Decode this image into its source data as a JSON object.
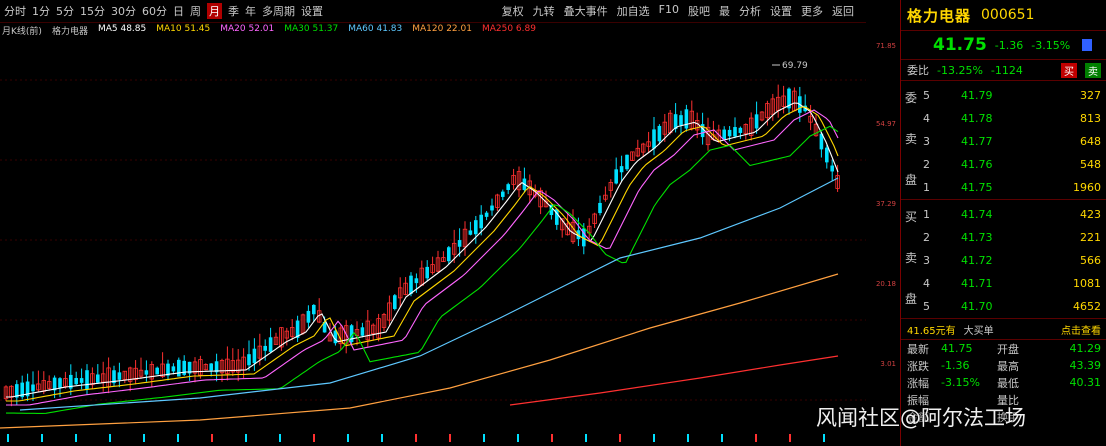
{
  "toolbar": {
    "periods": [
      "分时",
      "1分",
      "5分",
      "15分",
      "30分",
      "60分",
      "日",
      "周",
      "月",
      "季",
      "年",
      "多周期",
      "设置"
    ],
    "active_period": "月",
    "right_tools": [
      "复权",
      "九转",
      "叠大事件",
      "加自选",
      "F10",
      "股吧",
      "最",
      "分析",
      "设置",
      "更多",
      "返回"
    ]
  },
  "ma_legend": [
    {
      "text": "月K线(前)",
      "color": "#c8c8c8"
    },
    {
      "text": "格力电器",
      "color": "#c8c8c8"
    },
    {
      "text": "MA5 48.85",
      "color": "#ffffff"
    },
    {
      "text": "MA10 51.45",
      "color": "#ffd700"
    },
    {
      "text": "MA20 52.01",
      "color": "#ff66ff"
    },
    {
      "text": "MA30 51.37",
      "color": "#00e000"
    },
    {
      "text": "MA60 41.83",
      "color": "#5ec8ff"
    },
    {
      "text": "MA120 22.01",
      "color": "#ffa040"
    },
    {
      "text": "MA250 6.89",
      "color": "#ff3030"
    }
  ],
  "axis_labels": [
    "71.85",
    "54.97",
    "37.29",
    "20.18",
    "3.01"
  ],
  "peak_label": "69.79",
  "quote": {
    "name": "格力电器",
    "code": "000651",
    "price": "41.75",
    "change": "-1.36",
    "percent": "-3.15%"
  },
  "ratio": {
    "label": "委比",
    "value": "-13.25%",
    "diff": "-1124",
    "sell": "买",
    "buy": "卖"
  },
  "sell_side_label": [
    "委",
    "卖",
    "盘"
  ],
  "buy_side_label": [
    "买",
    "卖",
    "盘"
  ],
  "sell_levels": [
    {
      "level": "5",
      "price": "41.79",
      "volume": "327"
    },
    {
      "level": "4",
      "price": "41.78",
      "volume": "813"
    },
    {
      "level": "3",
      "price": "41.77",
      "volume": "648"
    },
    {
      "level": "2",
      "price": "41.76",
      "volume": "548"
    },
    {
      "level": "1",
      "price": "41.75",
      "volume": "1960"
    }
  ],
  "buy_levels": [
    {
      "level": "1",
      "price": "41.74",
      "volume": "423"
    },
    {
      "level": "2",
      "price": "41.73",
      "volume": "221"
    },
    {
      "level": "3",
      "price": "41.72",
      "volume": "566"
    },
    {
      "level": "4",
      "price": "41.71",
      "volume": "1081"
    },
    {
      "level": "5",
      "price": "41.70",
      "volume": "4652"
    }
  ],
  "bigdeal": {
    "left": "41.65元有",
    "mid": "大买单",
    "right": "点击查看"
  },
  "stats": [
    {
      "l1": "最新",
      "v1": "41.75",
      "l2": "开盘",
      "v2": "41.29"
    },
    {
      "l1": "涨跌",
      "v1": "-1.36",
      "l2": "最高",
      "v2": "43.39"
    },
    {
      "l1": "涨幅",
      "v1": "-3.15%",
      "l2": "最低",
      "v2": "40.31"
    },
    {
      "l1": "振幅",
      "v1": "",
      "l2": "量比",
      "v2": ""
    },
    {
      "l1": "金额",
      "v1": "",
      "l2": "换手",
      "v2": ""
    }
  ],
  "watermark": "风闻社区@阿尔法工场",
  "colors": {
    "up": "#ff3030",
    "down": "#00e0ff",
    "ma5": "#ffffff",
    "ma10": "#ffd700",
    "ma20": "#ff66ff",
    "ma30": "#00e000",
    "ma60": "#5ec8ff",
    "ma120": "#ffa040",
    "ma250": "#ff3030"
  }
}
